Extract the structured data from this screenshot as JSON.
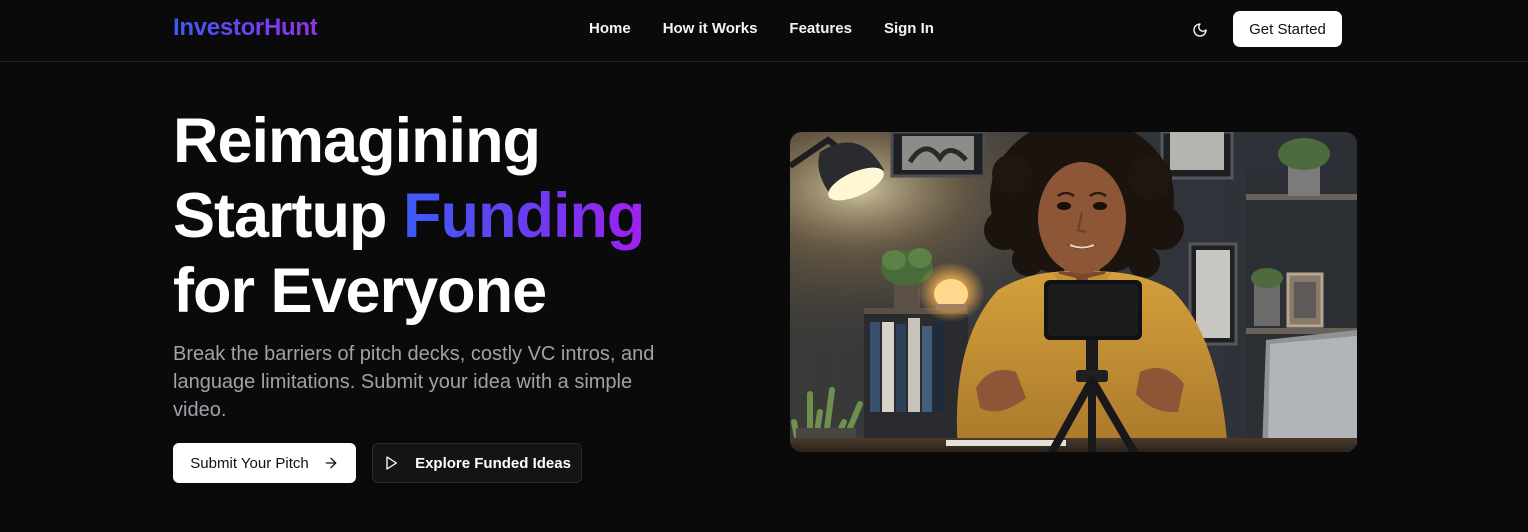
{
  "header": {
    "logo": "InvestorHunt",
    "nav": [
      "Home",
      "How it Works",
      "Features",
      "Sign In"
    ],
    "theme_toggle_icon": "moon-icon",
    "cta": "Get Started"
  },
  "hero": {
    "title_line1": "Reimagining",
    "title_line2_plain": "Startup ",
    "title_line2_accent": "Funding",
    "title_line3": "for Everyone",
    "subtitle": "Break the barriers of pitch decks, costly VC intros, and language limitations. Submit your idea with a simple video.",
    "primary_button": "Submit Your Pitch",
    "primary_button_icon": "arrow-right-icon",
    "secondary_button": "Explore Funded Ideas",
    "secondary_button_icon": "play-icon",
    "image_icon": "woman-recording-video-pitch-photo"
  },
  "colors": {
    "background": "#0a0a0b",
    "accent_start": "#3b5cf6",
    "accent_end": "#a020f0",
    "subtitle": "#a1a1aa",
    "button_light": "#ffffff"
  }
}
